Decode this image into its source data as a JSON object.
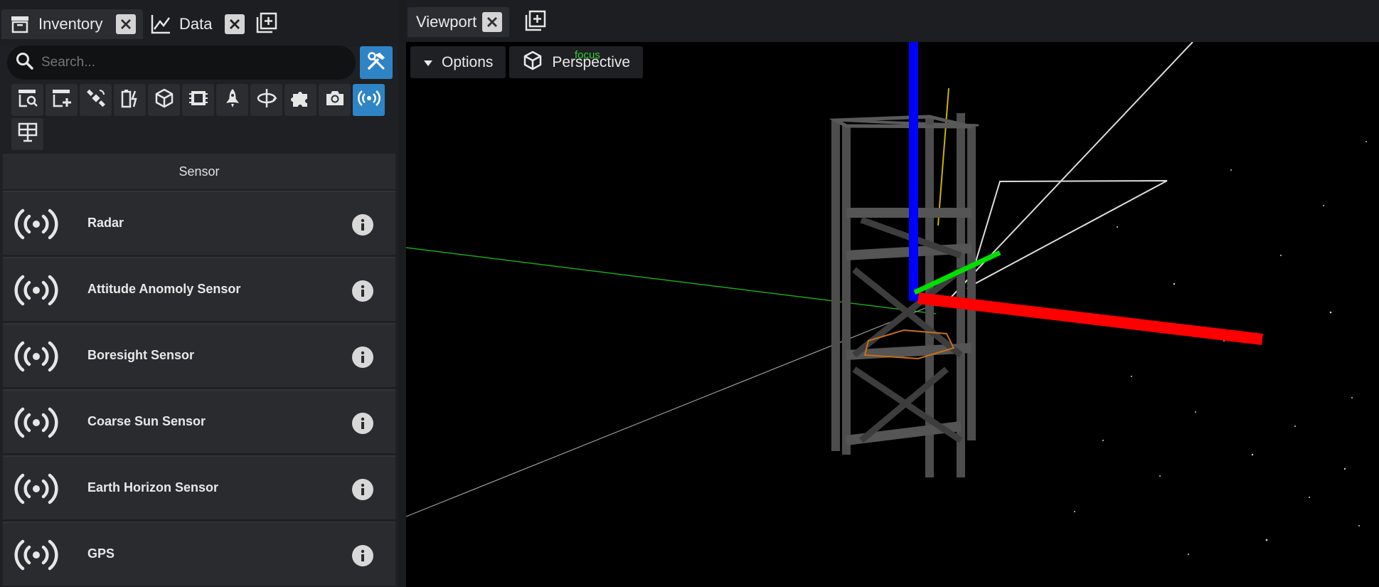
{
  "left_tabs": [
    {
      "label": "Inventory",
      "icon": "archive-icon"
    },
    {
      "label": "Data",
      "icon": "line-chart-icon"
    }
  ],
  "search": {
    "placeholder": "Search..."
  },
  "filters": [
    "inventory-search-icon",
    "inventory-add-icon",
    "satellite-icon",
    "battery-charging-icon",
    "cube-icon",
    "memory-chip-icon",
    "rocket-icon",
    "orbit-icon",
    "puzzle-icon",
    "camera-icon",
    "sensor-icon",
    "solar-panel-icon"
  ],
  "active_filter": "sensor-icon",
  "section_title": "Sensor",
  "items": [
    {
      "label": "Radar"
    },
    {
      "label": "Attitude Anomoly Sensor"
    },
    {
      "label": "Boresight Sensor"
    },
    {
      "label": "Coarse Sun Sensor"
    },
    {
      "label": "Earth Horizon Sensor"
    },
    {
      "label": "GPS"
    }
  ],
  "viewport": {
    "tab_label": "Viewport",
    "options_label": "Options",
    "camera_label": "Perspective",
    "focus_label": "focus"
  },
  "colors": {
    "accent": "#2f84c6",
    "axis_x": "#ff0000",
    "axis_y": "#00e000",
    "axis_z": "#0000ff"
  }
}
